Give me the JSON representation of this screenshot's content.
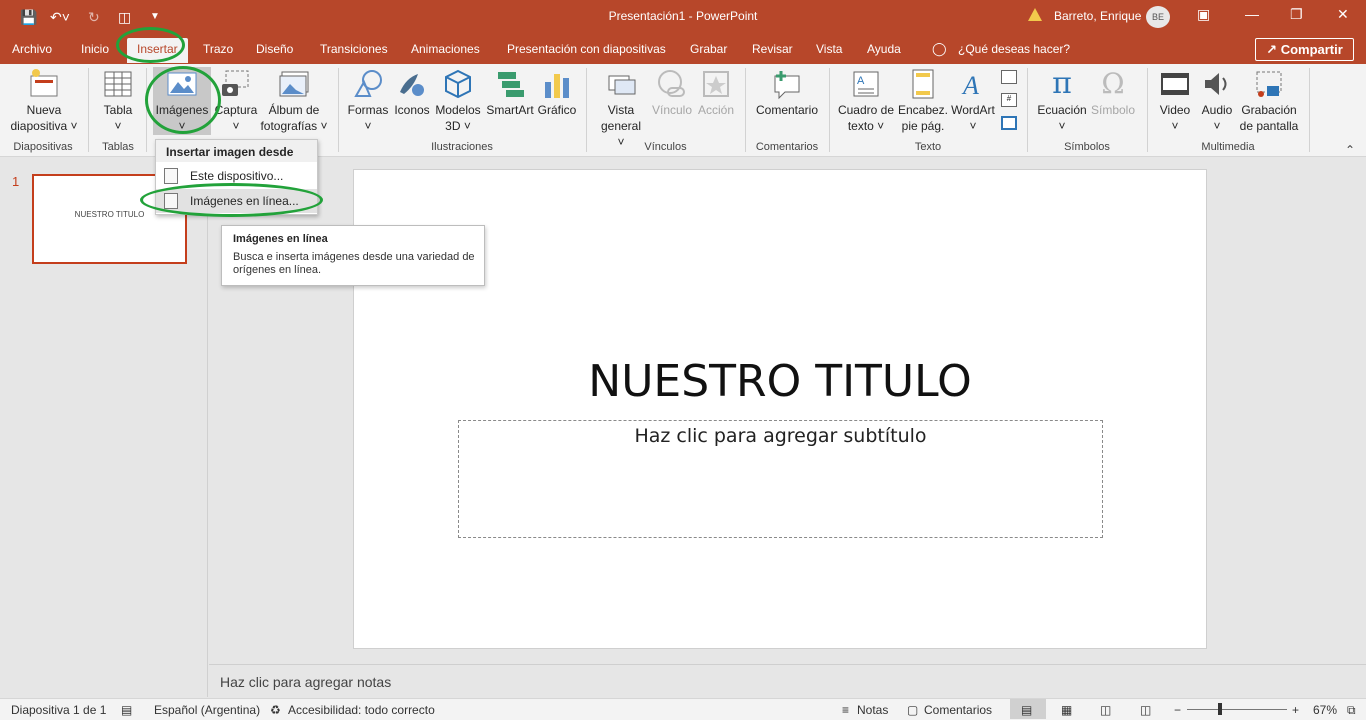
{
  "titlebar": {
    "doc_title": "Presentación1 - PowerPoint",
    "user_name": "Barreto, Enrique",
    "avatar_initials": "BE"
  },
  "tabs": [
    {
      "label": "Archivo"
    },
    {
      "label": "Inicio"
    },
    {
      "label": "Insertar"
    },
    {
      "label": "Trazo"
    },
    {
      "label": "Diseño"
    },
    {
      "label": "Transiciones"
    },
    {
      "label": "Animaciones"
    },
    {
      "label": "Presentación con diapositivas"
    },
    {
      "label": "Grabar"
    },
    {
      "label": "Revisar"
    },
    {
      "label": "Vista"
    },
    {
      "label": "Ayuda"
    }
  ],
  "tell_me": "¿Qué deseas hacer?",
  "share_label": "Compartir",
  "ribbon": {
    "buttons": {
      "nueva": "Nueva",
      "diapositiva": "diapositiva",
      "tabla": "Tabla",
      "imagenes": "Imágenes",
      "captura": "Captura",
      "album1": "Álbum de",
      "album2": "fotografías",
      "formas": "Formas",
      "iconos": "Iconos",
      "modelos1": "Modelos",
      "modelos2": "3D",
      "smartart": "SmartArt",
      "grafico": "Gráfico",
      "vista1": "Vista",
      "vista2": "general",
      "vinculo": "Vínculo",
      "accion": "Acción",
      "comentario": "Comentario",
      "cuadro1": "Cuadro de",
      "cuadro2": "texto",
      "encab1": "Encabez.",
      "encab2": "pie pág.",
      "wordart": "WordArt",
      "ecuacion": "Ecuación",
      "simbolo": "Símbolo",
      "video": "Video",
      "audio": "Audio",
      "grab1": "Grabación",
      "grab2": "de pantalla"
    },
    "groups": {
      "diapositivas": "Diapositivas",
      "tablas": "Tablas",
      "ilustraciones": "Ilustraciones",
      "vinculos": "Vínculos",
      "comentarios": "Comentarios",
      "texto": "Texto",
      "simbolos": "Símbolos",
      "multimedia": "Multimedia"
    }
  },
  "dropdown": {
    "header": "Insertar imagen desde",
    "items": [
      "Este dispositivo...",
      "Imágenes en línea..."
    ]
  },
  "tooltip": {
    "title": "Imágenes en línea",
    "description": "Busca e inserta imágenes desde una variedad de orígenes en línea."
  },
  "thumbnail": {
    "number": "1",
    "title": "NUESTRO TITULO"
  },
  "slide": {
    "title": "NUESTRO TITULO",
    "subtitle_placeholder": "Haz clic para agregar subtítulo"
  },
  "notes_placeholder": "Haz clic para agregar notas",
  "statusbar": {
    "slide_info": "Diapositiva 1 de 1",
    "language": "Español (Argentina)",
    "accessibility": "Accesibilidad: todo correcto",
    "notes": "Notas",
    "comments": "Comentarios",
    "zoom": "67%"
  },
  "colors": {
    "accent": "#b7472a",
    "highlight_ring": "#22a23a"
  }
}
